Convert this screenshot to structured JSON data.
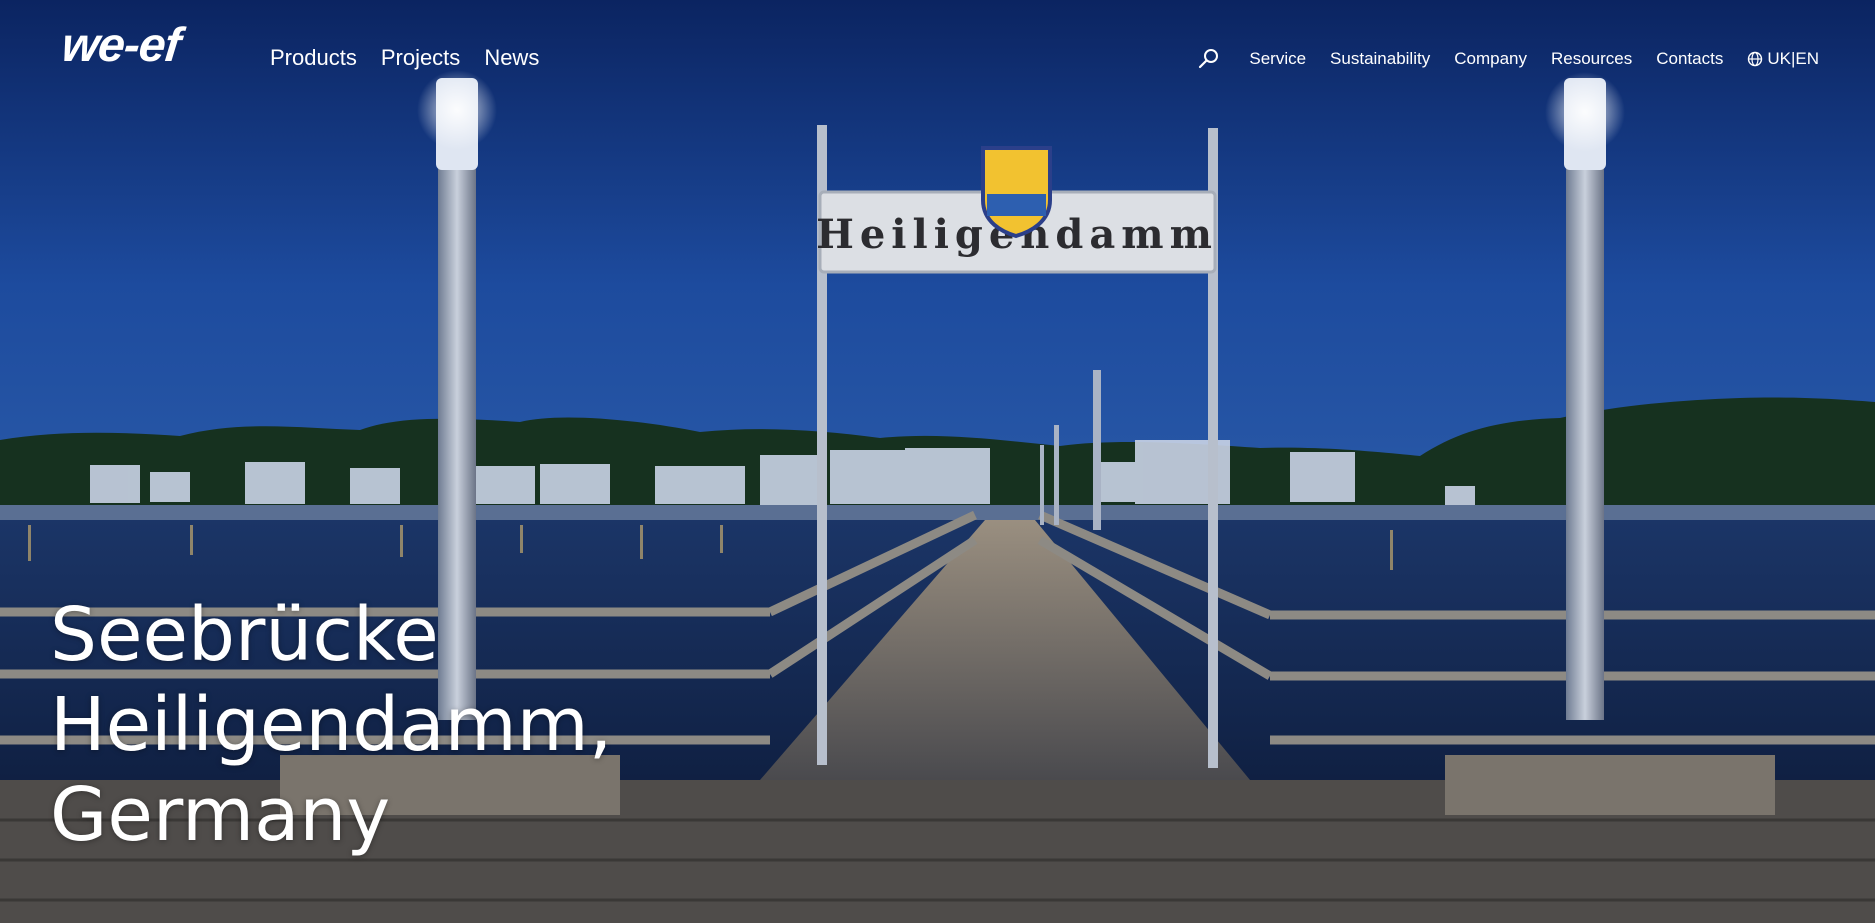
{
  "brand": {
    "logo_text": "we-ef"
  },
  "nav": {
    "primary": [
      {
        "label": "Products"
      },
      {
        "label": "Projects"
      },
      {
        "label": "News"
      }
    ],
    "secondary": [
      {
        "label": "Service"
      },
      {
        "label": "Sustainability"
      },
      {
        "label": "Company"
      },
      {
        "label": "Resources"
      },
      {
        "label": "Contacts"
      }
    ],
    "language": "UK|EN",
    "search_icon": "search-icon",
    "language_icon": "globe-icon"
  },
  "hero": {
    "title_lines": [
      "Seebrücke",
      "Heiligendamm,",
      "Germany"
    ],
    "sign_text": "Heiligendamm"
  },
  "colors": {
    "sky_top": "#0d2a66",
    "sky_bottom": "#1f4fa0",
    "water": "#13254a",
    "deck": "#6b6d72",
    "text": "#ffffff"
  }
}
